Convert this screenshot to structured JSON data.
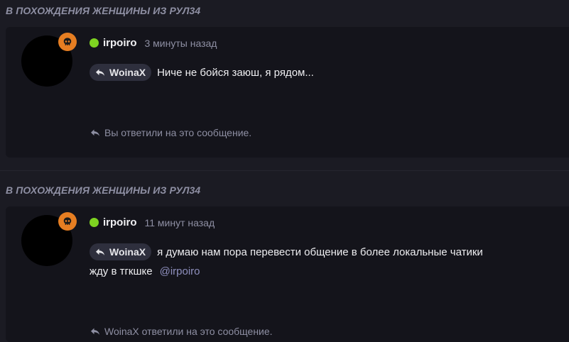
{
  "posts": [
    {
      "thread_title": "В ПОХОЖДЕНИЯ ЖЕНЩИНЫ ИЗ РУЛ34",
      "author": "irpoiro",
      "time": "3 минуты назад",
      "reply_to": "WoinaX",
      "message_lines": [
        "Ниче не бойся заюш, я рядом..."
      ],
      "mention": "",
      "footer_note": "Вы ответили на это сообщение."
    },
    {
      "thread_title": "В ПОХОЖДЕНИЯ ЖЕНЩИНЫ ИЗ РУЛ34",
      "author": "irpoiro",
      "time": "11 минут назад",
      "reply_to": "WoinaX",
      "message_lines": [
        "я думаю нам пора перевести общение в более локальные чатики",
        "жду в тгкшке"
      ],
      "mention": "@irpoiro",
      "footer_note": "WoinaX ответили на это сообщение."
    }
  ],
  "colors": {
    "background": "#1b1b23",
    "card": "#14141b",
    "online": "#7ed321",
    "badge": "#e67e22",
    "muted": "#8e8fa3",
    "mention": "#8e8fbd"
  },
  "icons": {
    "badge": "skull-icon",
    "reply": "reply-arrow-icon",
    "status": "online-status-icon"
  }
}
